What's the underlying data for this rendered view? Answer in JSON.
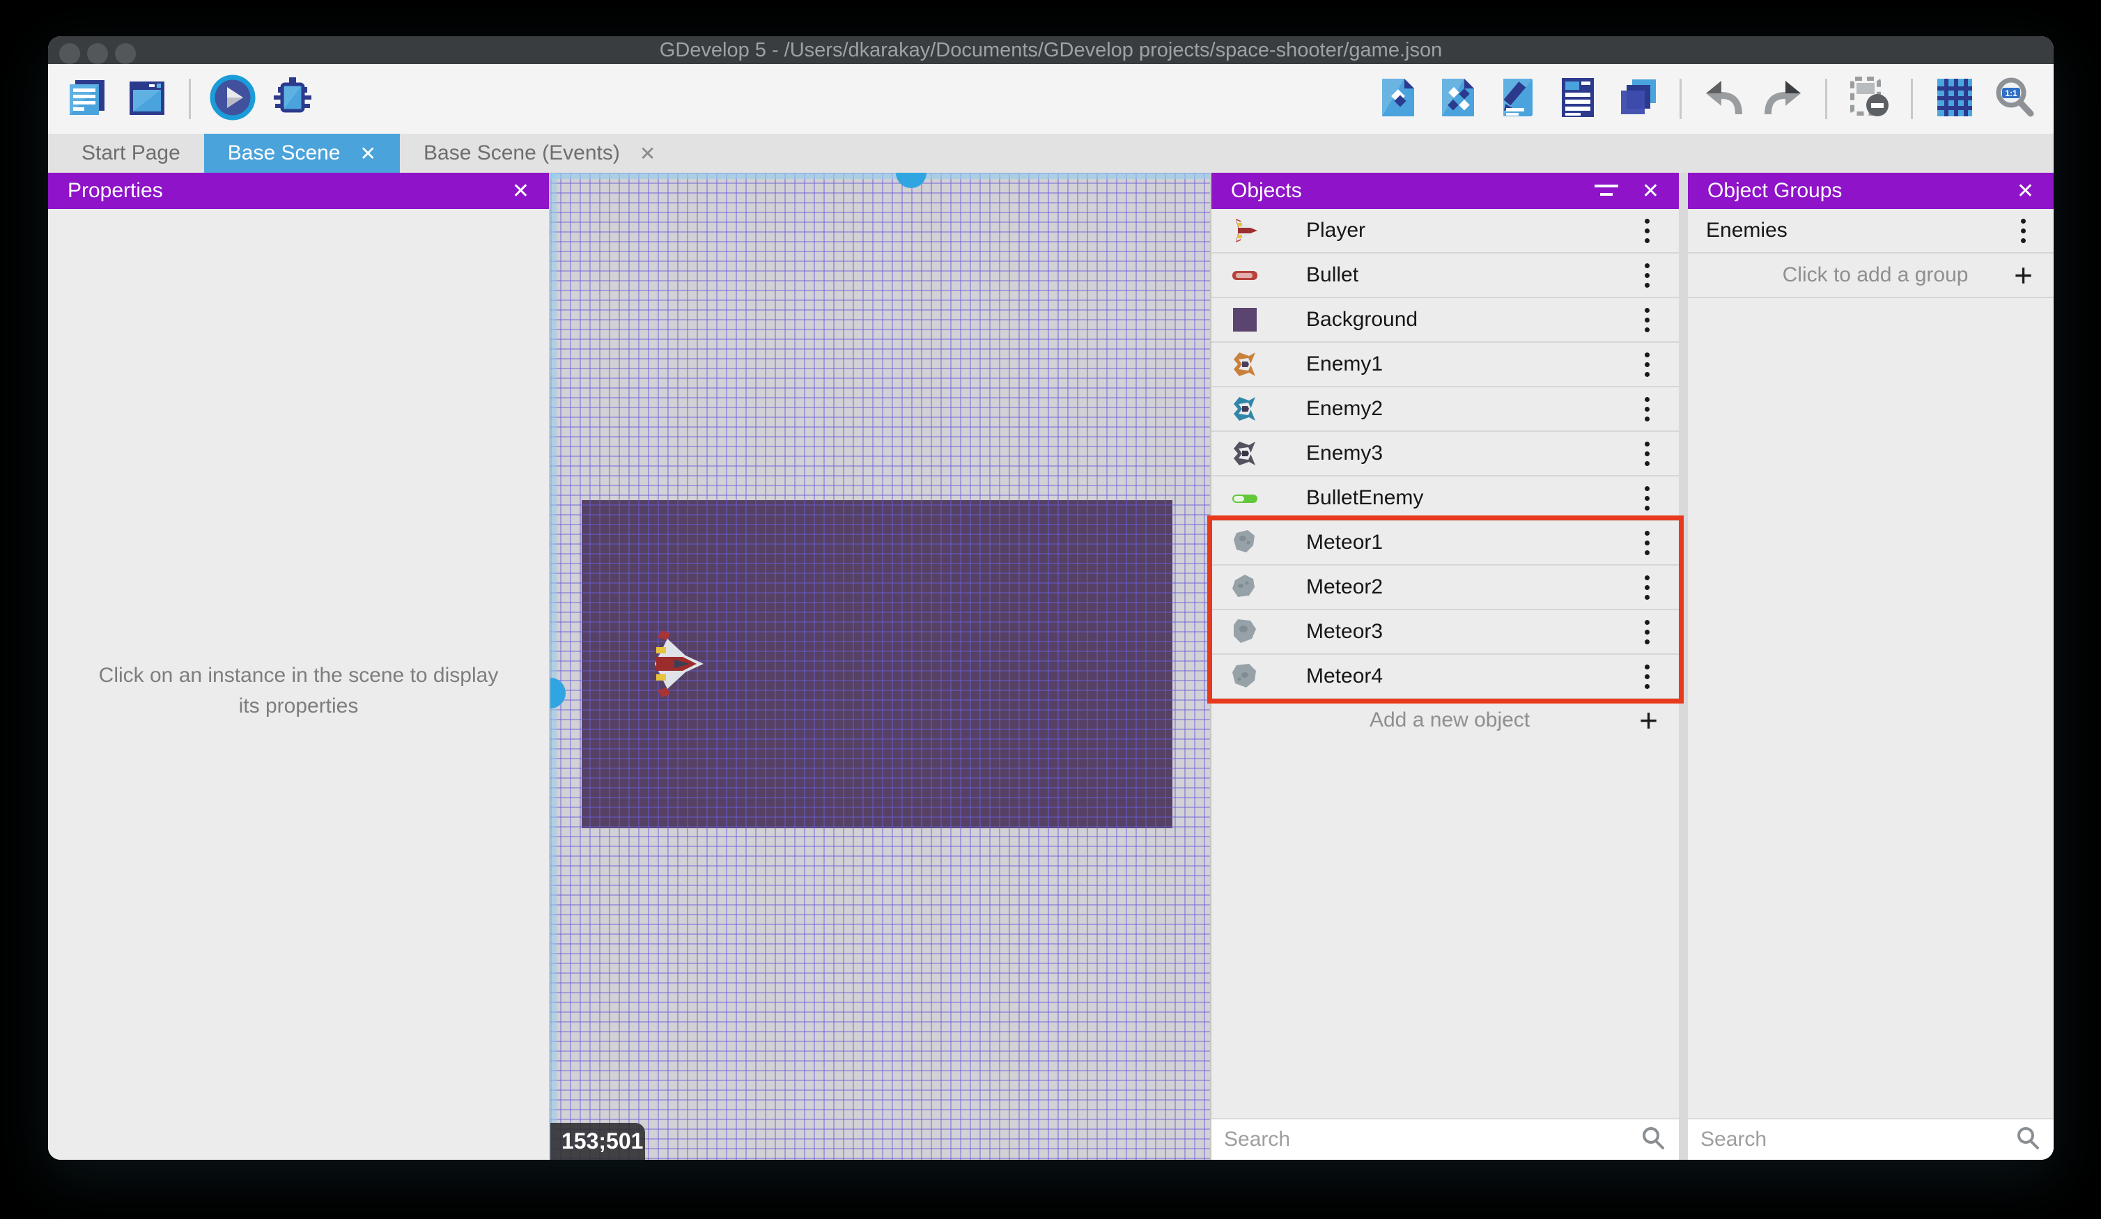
{
  "window": {
    "title": "GDevelop 5 - /Users/dkarakay/Documents/GDevelop projects/space-shooter/game.json"
  },
  "toolbar": {
    "left_icons": [
      "project-manager-icon",
      "window-icon",
      "play-icon",
      "debug-icon"
    ],
    "right_icons": [
      "objects-editor-icon",
      "object-groups-icon",
      "scene-properties-icon",
      "instances-list-icon",
      "layers-icon",
      "undo-icon",
      "redo-icon",
      "mask-icon",
      "grid-icon",
      "zoom-1-1-icon"
    ],
    "zoom_badge": "1:1"
  },
  "tabs": [
    {
      "label": "Start Page",
      "active": false
    },
    {
      "label": "Base Scene",
      "active": true
    },
    {
      "label": "Base Scene (Events)",
      "active": false
    }
  ],
  "icons": {
    "close": "✕",
    "plus": "+"
  },
  "properties_panel": {
    "title": "Properties",
    "empty_message": "Click on an instance in the scene to display its properties"
  },
  "scene": {
    "coordinates": "153;501",
    "fill_color": "#564165"
  },
  "objects_panel": {
    "title": "Objects",
    "items": [
      {
        "label": "Player",
        "icon": "player-ship-icon"
      },
      {
        "label": "Bullet",
        "icon": "bullet-icon"
      },
      {
        "label": "Background",
        "icon": "background-icon"
      },
      {
        "label": "Enemy1",
        "icon": "enemy1-ship-icon"
      },
      {
        "label": "Enemy2",
        "icon": "enemy2-ship-icon"
      },
      {
        "label": "Enemy3",
        "icon": "enemy3-ship-icon"
      },
      {
        "label": "BulletEnemy",
        "icon": "bullet-enemy-icon"
      },
      {
        "label": "Meteor1",
        "icon": "meteor-icon"
      },
      {
        "label": "Meteor2",
        "icon": "meteor-icon"
      },
      {
        "label": "Meteor3",
        "icon": "meteor-icon"
      },
      {
        "label": "Meteor4",
        "icon": "meteor-icon"
      }
    ],
    "highlighted_items": [
      "Meteor1",
      "Meteor2",
      "Meteor3",
      "Meteor4"
    ],
    "highlight_color": "#E9391D",
    "add_label": "Add a new object",
    "search_placeholder": "Search"
  },
  "object_groups_panel": {
    "title": "Object Groups",
    "groups": [
      {
        "label": "Enemies"
      }
    ],
    "add_label": "Click to add a group",
    "search_placeholder": "Search"
  },
  "colors": {
    "accent_purple": "#8F13C8",
    "tab_active_blue": "#4BA3DB"
  }
}
